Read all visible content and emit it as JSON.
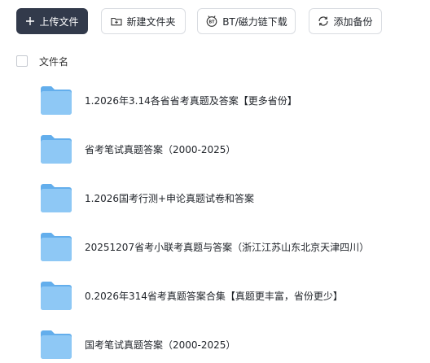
{
  "toolbar": {
    "upload_label": "上传文件",
    "new_folder_label": "新建文件夹",
    "bt_label": "BT/磁力链下载",
    "backup_label": "添加备份"
  },
  "header": {
    "column_name": "文件名"
  },
  "files": [
    {
      "name": "1.2026年3.14各省省考真题及答案【更多省份】"
    },
    {
      "name": "省考笔试真题答案（2000-2025）"
    },
    {
      "name": "1.2026国考行测+申论真题试卷和答案"
    },
    {
      "name": "20251207省考小联考真题与答案（浙江江苏山东北京天津四川）"
    },
    {
      "name": "0.2026年314省考真题答案合集【真题更丰富，省份更少】"
    },
    {
      "name": "国考笔试真题答案（2000-2025）"
    }
  ],
  "colors": {
    "primary_button": "#323a4b",
    "folder_front": "#8ec8f5",
    "folder_back": "#63aeec"
  }
}
